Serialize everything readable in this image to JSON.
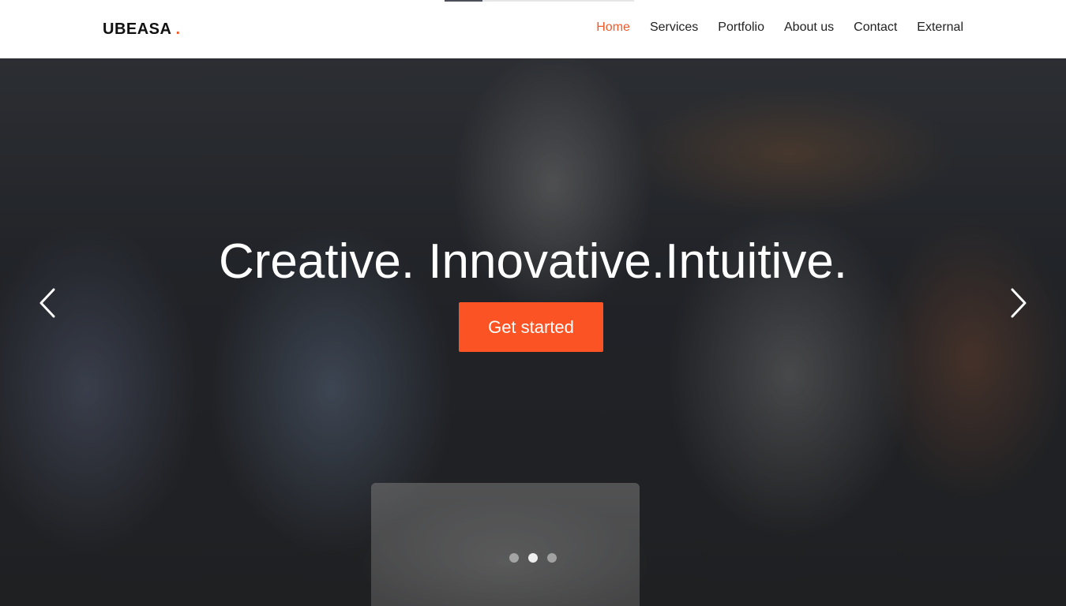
{
  "brand": {
    "name": "UBEASA",
    "dot": ".",
    "accent_color": "#f15a29"
  },
  "nav": {
    "items": [
      {
        "label": "Home",
        "active": true
      },
      {
        "label": "Services",
        "active": false
      },
      {
        "label": "Portfolio",
        "active": false
      },
      {
        "label": "About us",
        "active": false
      },
      {
        "label": "Contact",
        "active": false
      },
      {
        "label": "External",
        "active": false
      }
    ]
  },
  "hero": {
    "headline": "Creative. Innovative.Intuitive.",
    "cta_label": "Get started",
    "cta_color": "#fc5324",
    "prev_icon": "chevron-left-icon",
    "next_icon": "chevron-right-icon",
    "slide_count": 3,
    "active_slide": 2
  }
}
